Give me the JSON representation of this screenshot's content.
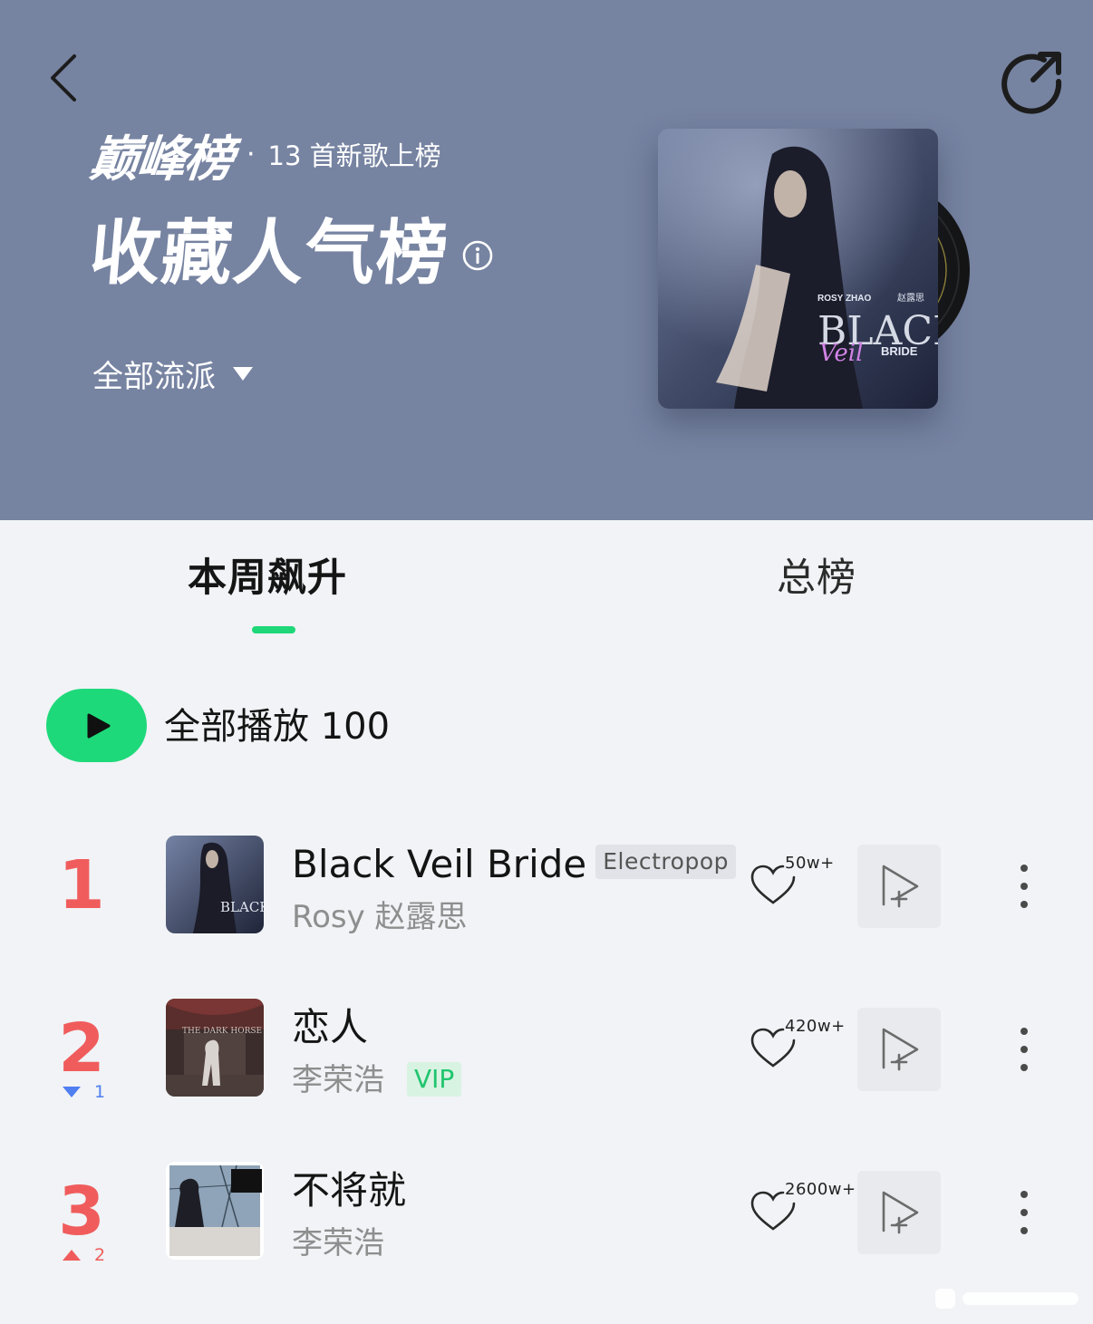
{
  "header": {
    "brand_logo": "巅峰榜",
    "brand_separator": "·",
    "brand_subtitle": "13 首新歌上榜",
    "chart_title": "收藏人气榜",
    "genre_filter": "全部流派",
    "back_icon": "chevron-left-icon",
    "share_icon": "share-arrow-icon",
    "info_icon": "info-icon",
    "caret_icon": "caret-down-icon",
    "background_color": "#7683a1",
    "cover_text": {
      "artist_en": "ROSY ZHAO",
      "artist_cn": "赵露思",
      "title_big": "BLACK",
      "title_script": "Veil",
      "title_small": "BRIDE"
    }
  },
  "tabs": [
    {
      "label": "本周飙升",
      "active": true
    },
    {
      "label": "总榜",
      "active": false
    }
  ],
  "play_all": {
    "label": "全部播放 100",
    "accent": "#1ed97a"
  },
  "songs": [
    {
      "rank": "1",
      "title": "Black Veil Bride",
      "genre_tag": "Electropop",
      "artist": "Rosy 赵露思",
      "favorites": "50w+",
      "cover_text": "BLACK"
    },
    {
      "rank": "2",
      "change_dir": "down",
      "change_amount": "1",
      "title": "恋人",
      "artist": "李荣浩",
      "badge": "VIP",
      "favorites": "420w+",
      "cover_text": "THE DARK HORSE"
    },
    {
      "rank": "3",
      "change_dir": "up",
      "change_amount": "2",
      "title": "不将就",
      "artist": "李荣浩",
      "favorites": "2600w+"
    }
  ],
  "colors": {
    "rank_red": "#f05c5c",
    "down_blue": "#4f7ff0",
    "vip_green": "#1fc56e"
  }
}
